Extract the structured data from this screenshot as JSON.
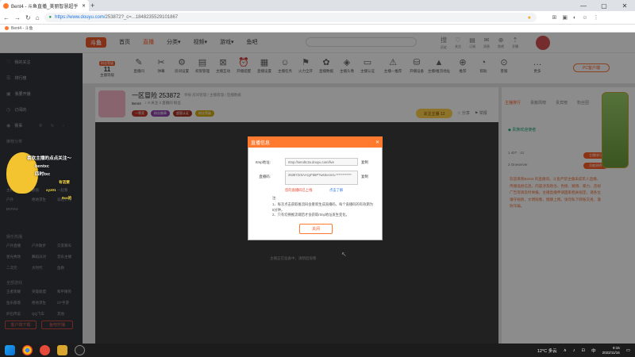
{
  "browser": {
    "tab_title": "Bent4 - 斗鱼直播_美丽智慧超乎",
    "new_tab": "+",
    "url_domain": "https://www.douyu.com/",
    "url_path": "253872?_c=...1848235529101867",
    "bookmark": "Bent4 - 斗鱼",
    "window_controls": [
      "—",
      "▢",
      "✕"
    ]
  },
  "site": {
    "logo": "斗鱼",
    "nav": [
      "首页",
      "直播",
      "分类▾",
      "视频▾",
      "游戏▾",
      "鱼吧"
    ],
    "nav_active_index": 1,
    "user_icons": [
      {
        "icon": "搜",
        "label": "历史"
      },
      {
        "icon": "♡",
        "label": "关注"
      },
      {
        "icon": "▤",
        "label": "订阅"
      },
      {
        "icon": "✉",
        "label": "消息"
      },
      {
        "icon": "⊕",
        "label": "鱼吧"
      },
      {
        "icon": "⇡",
        "label": "开播"
      }
    ]
  },
  "sidebar": {
    "items": [
      {
        "icon": "♡",
        "label": "我的关注"
      },
      {
        "icon": "☰",
        "label": "排行榜"
      },
      {
        "icon": "▣",
        "label": "我要开播"
      },
      {
        "icon": "◷",
        "label": "订阅的"
      },
      {
        "icon": "◉",
        "label": "赛事"
      }
    ],
    "section1_header": "推荐分类",
    "section1_subs": [
      "王者荣耀",
      "英雄联盟",
      "和平精英",
      "绝地求生",
      "穿越火线",
      "DOTA2",
      "主机游戏",
      "颜值",
      "一起看",
      "户外"
    ],
    "section2_header": "娱乐热播",
    "section2_subs": [
      "户外直播",
      "户外散步",
      "交友聊天",
      "星光秀场",
      "舞蹈派对",
      "音乐主播",
      "二次元",
      "大时代",
      "鱼教"
    ],
    "section3_header": "全部游戏",
    "section3_subs": [
      "王者荣耀",
      "英雄联盟",
      "和平精英",
      "鱼乐部落",
      "绝地求生",
      "CF手游",
      "炉石传说",
      "QQ飞车",
      "其他"
    ],
    "btn_left": "客户端下载",
    "btn_right": "鱼吧开播"
  },
  "catbar": {
    "level_badge": "粉丝等级",
    "level_num": "11",
    "level_label": "主播等级",
    "items": [
      {
        "icon": "✎",
        "label": "直播间"
      },
      {
        "icon": "✂",
        "label": "弹幕"
      },
      {
        "icon": "⚙",
        "label": "房间设置"
      },
      {
        "icon": "▤",
        "label": "权限管理"
      },
      {
        "icon": "⊠",
        "label": "主播互动"
      },
      {
        "icon": "⏰",
        "label": "开播提醒"
      },
      {
        "icon": "▦",
        "label": "直播设置"
      },
      {
        "icon": "☺",
        "label": "主播任务"
      },
      {
        "icon": "⚑",
        "label": "火力全开"
      },
      {
        "icon": "✿",
        "label": "直播数据"
      },
      {
        "icon": "◈",
        "label": "主播头像"
      },
      {
        "icon": "▭",
        "label": "主播认证"
      },
      {
        "icon": "⚠",
        "label": "主播—推荐"
      },
      {
        "icon": "⛁",
        "label": "开播设备"
      },
      {
        "icon": "▲",
        "label": "主播/推流地址"
      },
      {
        "icon": "⊕",
        "label": "推荐"
      },
      {
        "icon": "◔",
        "label": "帮助"
      },
      {
        "icon": "⊙",
        "label": "客服"
      },
      {
        "icon": "…",
        "label": "更多"
      }
    ],
    "pc_button": "PC客户端"
  },
  "stream": {
    "title": "一区冒险 253872",
    "meta": "举报   房间管理 / 主播管理 / 直播数据",
    "line2_user": "Bent4",
    "line2_rest": "♀ 8   关注 3   直播间 粉丝",
    "tags": [
      {
        "text": "一等奖",
        "color": "#c0392b"
      },
      {
        "text": "粉丝徽章",
        "color": "#8e44ad"
      },
      {
        "text": "超管认证",
        "color": "#a93226"
      },
      {
        "text": "粉丝等级",
        "color": "#d4ac0d"
      }
    ],
    "follow": "关注主播  12",
    "share_icons": [
      "☆ 分享",
      "⚑ 举报"
    ]
  },
  "player": {
    "tip": "主播正在准备中，请稍后观看",
    "cursor": "↖"
  },
  "right_panel": {
    "tabs": [
      "主播排行",
      "贡献周榜",
      "贵宾榜",
      "粉丝团"
    ],
    "active_tab": 0,
    "notice": "◆ 贵族欢迎使者",
    "ranks": [
      "1  407 · 41",
      "2  Oneserver"
    ],
    "chat": "欢迎来到Bent4 的直播间。斗鱼严禁主播未成年人直播、传播低俗信息。内容涉及政治、色情、赌博、暴力、违规广告等请及时举报。主播直播申请国家相关规定，请各位遵守规则，文明观看，健康上网。请勿私下转账交易，谨防诈骗。",
    "badges": [
      "主播排行",
      "贡献周榜"
    ]
  },
  "dialog": {
    "title": "直播信息",
    "close_icon": "✕",
    "rtmp_label": "rtmp地址:",
    "rtmp_value": "rtmp://sendtc3a.douyu.com/live",
    "key_label": "直播码:",
    "key_value": "253872rSAA1yF55P?wsSecret=************",
    "copy": "复制",
    "link_red": "您的直播码已上线",
    "link_blue": "点击了解",
    "note_title": "注:",
    "notes": [
      "1、每次点击获取推流码会重新生成直播码，每个直播码的有效期为5分钟。",
      "2、只有切换推流端后才会获取rtmp地址发生变化。"
    ],
    "close_button": "关闭"
  },
  "overlay_msg": {
    "line1": "喜欢主播的点点关注～",
    "line2": "bentxc",
    "line3": "四时txc",
    "line4": "有话要",
    "line5": "xyz01",
    "line6": "9xs的"
  },
  "taskbar": {
    "temp": "12°C 多云",
    "time": "9:15",
    "date": "2022/11/16",
    "tray": [
      "∧",
      "♪",
      "⊡",
      "中"
    ]
  }
}
